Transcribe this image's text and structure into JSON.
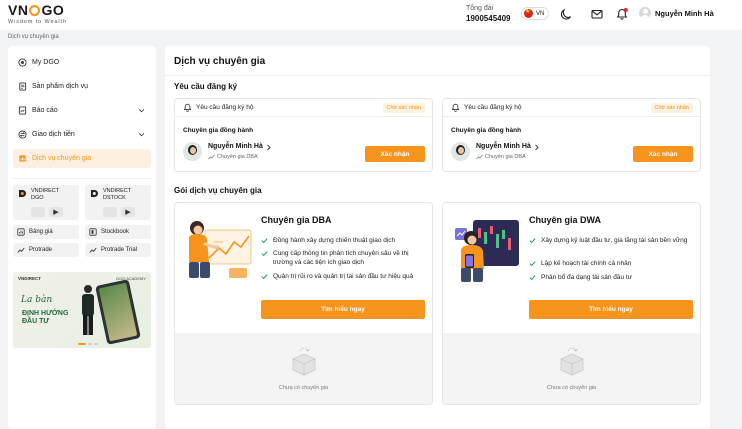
{
  "brand": {
    "logo_main_left": "VN",
    "logo_main_right": "GO",
    "tagline": "Wisdom to Wealth",
    "accent": "#f7941d"
  },
  "header": {
    "hotline_label": "Tổng đài",
    "hotline_number": "1900545409",
    "lang": "VN",
    "user_name": "Nguyễn Minh Hà"
  },
  "breadcrumb": "Dịch vụ chuyên gia",
  "sidebar": {
    "items": [
      {
        "label": "My DGO",
        "icon": "target-icon"
      },
      {
        "label": "Sản phẩm dịch vụ",
        "icon": "document-icon"
      },
      {
        "label": "Báo cáo",
        "icon": "report-icon"
      },
      {
        "label": "Giao dịch tiền",
        "icon": "exchange-icon"
      },
      {
        "label": "Dịch vụ chuyên gia",
        "icon": "bar-chart-icon"
      }
    ],
    "apps": [
      {
        "name_line1": "VNDIRECT",
        "name_line2": "DGO"
      },
      {
        "name_line1": "VNDIRECT",
        "name_line2": "DSTOCK"
      }
    ],
    "links": [
      "Bảng giá",
      "Stockbook",
      "Protrade",
      "Protrade Trial"
    ],
    "banner": {
      "brand": "VNDIRECT",
      "academy": "DGO ACADEMY",
      "title_line1": "La bàn",
      "title_line2": "ĐỊNH HƯỚNG",
      "title_line3": "ĐẦU TƯ"
    }
  },
  "main": {
    "title": "Dịch vụ chuyên gia",
    "requests_title": "Yêu cầu đăng ký",
    "requests": [
      {
        "header": "Yêu cầu đăng ký hộ",
        "status": "Chờ xác nhận",
        "role": "Chuyên gia đồng hành",
        "name": "Nguyễn Minh Hà",
        "expert_type": "Chuyên gia DBA",
        "action": "Xác nhận"
      },
      {
        "header": "Yêu cầu đăng ký hộ",
        "status": "Chờ xác nhận",
        "role": "Chuyên gia đồng hành",
        "name": "Nguyễn Minh Hà",
        "expert_type": "Chuyên gia DBA",
        "action": "Xác nhận"
      }
    ],
    "packages_title": "Gói dịch vụ chuyên gia",
    "packages": [
      {
        "title": "Chuyên gia DBA",
        "features": [
          "Đồng hành xây dựng chiến thuật giao dịch",
          "Cung cấp thông tin phân tích chuyên sâu về thị trường và các tiện ích giao dịch",
          "Quản trị rủi ro và quản trị tài sản đầu tư hiệu quả"
        ],
        "button": "Tìm hiểu ngay",
        "empty_text": "Chưa có chuyên gia"
      },
      {
        "title": "Chuyên gia DWA",
        "features": [
          "Xây dựng kỷ luật đầu tư, gia tăng tài sản bền vững",
          "Lập kế hoạch tài chính cá nhân",
          "Phân bổ đa dạng tài sản đầu tư"
        ],
        "button": "Tìm hiểu ngay",
        "empty_text": "Chưa có chuyên gia"
      }
    ]
  }
}
